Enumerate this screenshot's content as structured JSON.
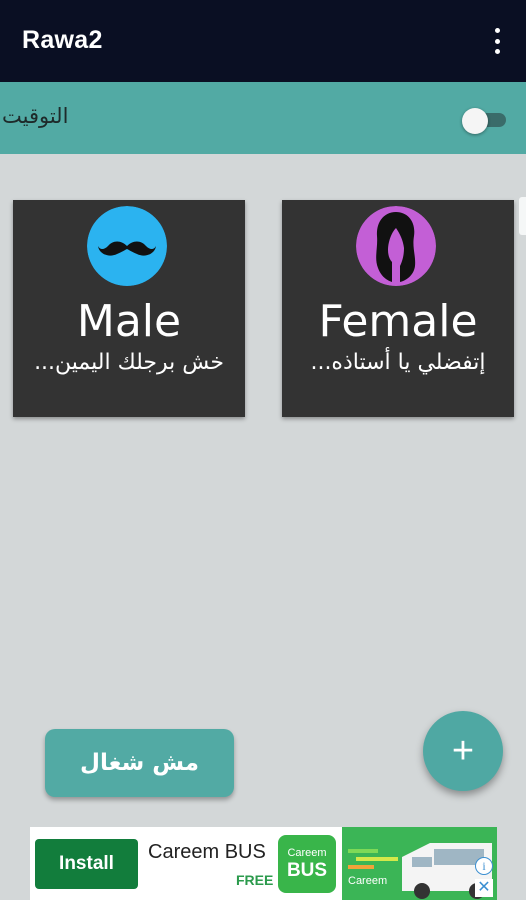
{
  "appbar": {
    "title": "Rawa2",
    "menu_icon": "more-vert-icon"
  },
  "timer": {
    "label": "التوقيت",
    "enabled": false
  },
  "cards": [
    {
      "title": "Male",
      "subtitle": "خش برجلك اليمين...",
      "avatar_icon": "mustache-icon",
      "avatar_color": "#2bb3f0"
    },
    {
      "title": "Female",
      "subtitle": "إتفضلي يا أستاذه...",
      "avatar_icon": "woman-silhouette-icon",
      "avatar_color": "#c35fd6"
    }
  ],
  "busy_button": {
    "label": "مش شغال"
  },
  "fab": {
    "label": "+",
    "icon": "plus-icon"
  },
  "ad": {
    "install_label": "Install",
    "name": "Careem BUS",
    "price": "FREE",
    "logo_line1": "Careem",
    "logo_line2": "BUS",
    "banner_brand": "Careem"
  },
  "colors": {
    "accent": "#52aaa4",
    "appbar": "#0a0f23",
    "card": "#333333",
    "background": "#d3d7d8"
  }
}
